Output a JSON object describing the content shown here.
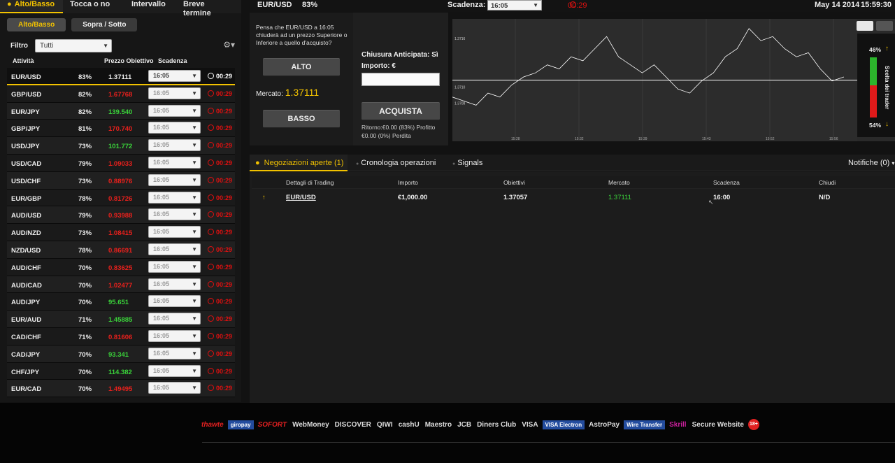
{
  "left_tabs": [
    "Alto/Basso",
    "Tocca o no",
    "Intervallo",
    "Breve termine"
  ],
  "sub_tabs": [
    "Alto/Basso",
    "Sopra / Sotto"
  ],
  "filter": {
    "label": "Filtro",
    "value": "Tutti"
  },
  "columns": {
    "asset": "Attività",
    "target": "Prezzo Obiettivo",
    "expiry": "Scadenza"
  },
  "assets": [
    {
      "name": "EUR/USD",
      "pct": "83%",
      "price": "1.37111",
      "color": "white",
      "expiry": "16:05",
      "timer": "00:29",
      "selected": true
    },
    {
      "name": "GBP/USD",
      "pct": "82%",
      "price": "1.67768",
      "color": "red",
      "expiry": "16:05",
      "timer": "00:29"
    },
    {
      "name": "EUR/JPY",
      "pct": "82%",
      "price": "139.540",
      "color": "green",
      "expiry": "16:05",
      "timer": "00:29"
    },
    {
      "name": "GBP/JPY",
      "pct": "81%",
      "price": "170.740",
      "color": "red",
      "expiry": "16:05",
      "timer": "00:29"
    },
    {
      "name": "USD/JPY",
      "pct": "73%",
      "price": "101.772",
      "color": "green",
      "expiry": "16:05",
      "timer": "00:29"
    },
    {
      "name": "USD/CAD",
      "pct": "79%",
      "price": "1.09033",
      "color": "red",
      "expiry": "16:05",
      "timer": "00:29"
    },
    {
      "name": "USD/CHF",
      "pct": "73%",
      "price": "0.88976",
      "color": "red",
      "expiry": "16:05",
      "timer": "00:29"
    },
    {
      "name": "EUR/GBP",
      "pct": "78%",
      "price": "0.81726",
      "color": "red",
      "expiry": "16:05",
      "timer": "00:29"
    },
    {
      "name": "AUD/USD",
      "pct": "79%",
      "price": "0.93988",
      "color": "red",
      "expiry": "16:05",
      "timer": "00:29"
    },
    {
      "name": "AUD/NZD",
      "pct": "73%",
      "price": "1.08415",
      "color": "red",
      "expiry": "16:05",
      "timer": "00:29"
    },
    {
      "name": "NZD/USD",
      "pct": "78%",
      "price": "0.86691",
      "color": "red",
      "expiry": "16:05",
      "timer": "00:29"
    },
    {
      "name": "AUD/CHF",
      "pct": "70%",
      "price": "0.83625",
      "color": "red",
      "expiry": "16:05",
      "timer": "00:29"
    },
    {
      "name": "AUD/CAD",
      "pct": "70%",
      "price": "1.02477",
      "color": "red",
      "expiry": "16:05",
      "timer": "00:29"
    },
    {
      "name": "AUD/JPY",
      "pct": "70%",
      "price": "95.651",
      "color": "green",
      "expiry": "16:05",
      "timer": "00:29"
    },
    {
      "name": "EUR/AUD",
      "pct": "71%",
      "price": "1.45885",
      "color": "green",
      "expiry": "16:05",
      "timer": "00:29"
    },
    {
      "name": "CAD/CHF",
      "pct": "71%",
      "price": "0.81606",
      "color": "red",
      "expiry": "16:05",
      "timer": "00:29"
    },
    {
      "name": "CAD/JPY",
      "pct": "70%",
      "price": "93.341",
      "color": "green",
      "expiry": "16:05",
      "timer": "00:29"
    },
    {
      "name": "CHF/JPY",
      "pct": "70%",
      "price": "114.382",
      "color": "green",
      "expiry": "16:05",
      "timer": "00:29"
    },
    {
      "name": "EUR/CAD",
      "pct": "70%",
      "price": "1.49495",
      "color": "red",
      "expiry": "16:05",
      "timer": "00:29"
    }
  ],
  "topbar": {
    "asset": "EUR/USD",
    "pct": "83%",
    "expiry_label": "Scadenza:",
    "expiry_value": "16:05",
    "timer": "00:29",
    "date": "May 14 2014",
    "time": "15:59:30"
  },
  "trade": {
    "question": "Pensa che EUR/USD a 16:05 chiuderà ad un prezzo Superiore o Inferiore a quello d'acquisto?",
    "alto": "ALTO",
    "basso": "BASSO",
    "market_label": "Mercato:",
    "market_value": "1.37111",
    "early_close": "Chiusura Anticipata: Sì",
    "amount_label": "Importo: €",
    "buy": "ACQUISTA",
    "return_text": "Ritorno:€0.00 (83%) Profitto €0.00 (0%) Perdita"
  },
  "gauge": {
    "title": "Scelta dei trader",
    "up_pct": "46%",
    "down_pct": "54%"
  },
  "chart_data": {
    "type": "line",
    "y_ticks": [
      "1.3716",
      "1.3710",
      "1.3708"
    ],
    "x_ticks": [
      "15:28",
      "15:32",
      "15:39",
      "15:43",
      "15:52",
      "15:56"
    ],
    "y_range": [
      1.3705,
      1.3718
    ],
    "target_line": 1.37111,
    "values": [
      1.3709,
      1.37085,
      1.3708,
      1.37095,
      1.3709,
      1.37105,
      1.37115,
      1.3712,
      1.3713,
      1.37125,
      1.3714,
      1.37135,
      1.3715,
      1.37165,
      1.3714,
      1.3713,
      1.3712,
      1.3713,
      1.37115,
      1.371,
      1.37095,
      1.3711,
      1.3712,
      1.3714,
      1.3715,
      1.37175,
      1.3716,
      1.37165,
      1.3715,
      1.3714,
      1.37145,
      1.37125,
      1.3711,
      1.37115
    ]
  },
  "bottom_tabs": [
    "Negoziazioni aperte (1)",
    "Cronologia operazioni",
    "Signals"
  ],
  "notifications": "Notifiche (0)",
  "table": {
    "headers": [
      "Dettagli di Trading",
      "Importo",
      "Obiettivi",
      "Mercato",
      "Scadenza",
      "Chiudi"
    ],
    "row": {
      "asset": "EUR/USD",
      "amount": "€1,000.00",
      "target": "1.37057",
      "market": "1.37111",
      "expiry": "16:00",
      "close": "N/D"
    }
  },
  "footer_logos": [
    "thawte",
    "giropay",
    "SOFORT",
    "WebMoney",
    "DISCOVER",
    "QIWI",
    "cashU",
    "Maestro",
    "JCB",
    "Diners Club",
    "VISA",
    "VISA Electron",
    "AstroPay",
    "Wire Transfer",
    "Skrill",
    "Secure Website",
    "18+"
  ],
  "colors": {
    "accent": "#f2c200",
    "up": "#3ad13a",
    "down": "#e8201c"
  }
}
